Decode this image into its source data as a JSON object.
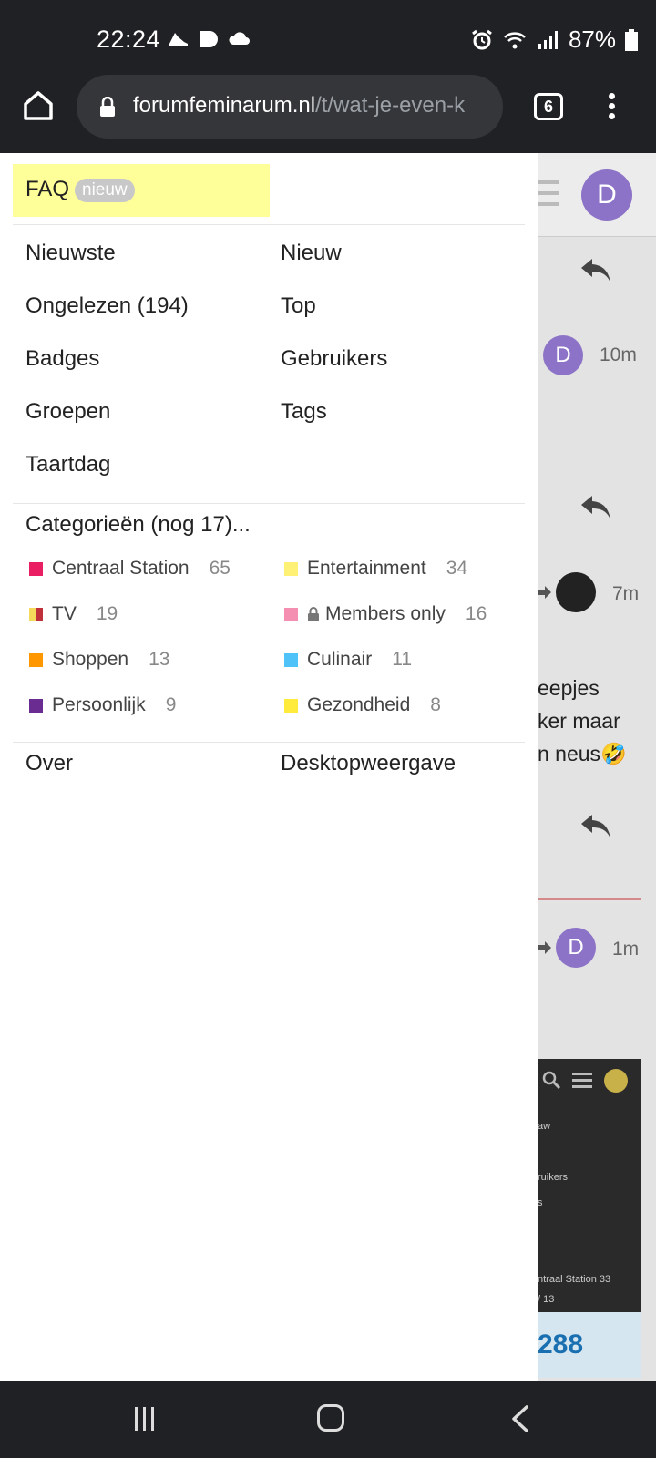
{
  "status": {
    "time": "22:24",
    "battery": "87%"
  },
  "browser": {
    "url_host": "forumfeminarum.nl",
    "url_path": "/t/wat-je-even-k",
    "tab_count": "6"
  },
  "background": {
    "avatar_letter": "D",
    "posts": [
      {
        "avatar": "D",
        "time": "10m"
      },
      {
        "avatar": "",
        "time": "7m"
      },
      {
        "avatar": "D",
        "time": "1m"
      }
    ],
    "text_lines": [
      "eepjes",
      "ker maar",
      "n neus🤣"
    ],
    "shot_lines": [
      "aw",
      "ruikers",
      "s",
      "ntraal Station   33",
      "/    13"
    ],
    "shot_number": "288"
  },
  "menu": {
    "faq": {
      "label": "FAQ",
      "badge": "nieuw",
      "highlight": "#ffff99"
    },
    "links": {
      "latest": "Nieuwste",
      "new": "Nieuw",
      "unread": "Ongelezen (194)",
      "top": "Top",
      "badges": "Badges",
      "users": "Gebruikers",
      "groups": "Groepen",
      "tags": "Tags",
      "cakeday": "Taartdag"
    },
    "categories_heading": "Categorieën (nog 17)...",
    "categories": [
      {
        "name": "Centraal Station",
        "count": "65",
        "color": "#e91e63"
      },
      {
        "name": "Entertainment",
        "count": "34",
        "color": "#fff176"
      },
      {
        "name": "TV",
        "count": "19",
        "color": "#f5d95b"
      },
      {
        "name": "Members only",
        "count": "16",
        "color": "#f48fb1"
      },
      {
        "name": "Shoppen",
        "count": "13",
        "color": "#ff9800"
      },
      {
        "name": "Culinair",
        "count": "11",
        "color": "#4fc3f7"
      },
      {
        "name": "Persoonlijk",
        "count": "9",
        "color": "#6a2c91"
      },
      {
        "name": "Gezondheid",
        "count": "8",
        "color": "#ffeb3b"
      }
    ],
    "footer": {
      "about": "Over",
      "desktop": "Desktopweergave"
    }
  }
}
